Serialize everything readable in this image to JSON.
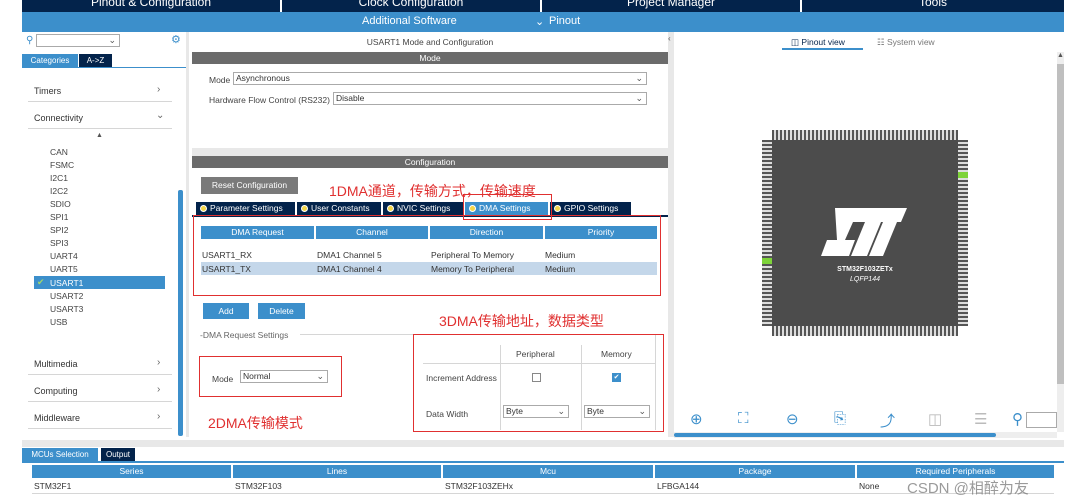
{
  "top_tabs": [
    "Pinout & Configuration",
    "Clock Configuration",
    "Project Manager",
    "Tools"
  ],
  "sub_menu": {
    "additional": "Additional Software",
    "pinout": "Pinout"
  },
  "left": {
    "cat_tab": "Categories",
    "az_tab": "A->Z",
    "categories": [
      "Timers",
      "Connectivity",
      "Multimedia",
      "Computing",
      "Middleware"
    ],
    "peripherals": [
      "CAN",
      "FSMC",
      "I2C1",
      "I2C2",
      "SDIO",
      "SPI1",
      "SPI2",
      "SPI3",
      "UART4",
      "UART5",
      "USART1",
      "USART2",
      "USART3",
      "USB"
    ],
    "selected": "USART1"
  },
  "mode_panel": {
    "title": "USART1 Mode and Configuration",
    "mode_header": "Mode",
    "mode_label": "Mode",
    "mode_value": "Asynchronous",
    "flow_label": "Hardware Flow Control (RS232)",
    "flow_value": "Disable"
  },
  "config": {
    "header": "Configuration",
    "reset": "Reset Configuration",
    "tabs": [
      "Parameter Settings",
      "User Constants",
      "NVIC Settings",
      "DMA Settings",
      "GPIO Settings"
    ],
    "dma_columns": [
      "DMA Request",
      "Channel",
      "Direction",
      "Priority"
    ],
    "dma_rows": [
      [
        "USART1_RX",
        "DMA1 Channel 5",
        "Peripheral To Memory",
        "Medium"
      ],
      [
        "USART1_TX",
        "DMA1 Channel 4",
        "Memory To Peripheral",
        "Medium"
      ]
    ],
    "add": "Add",
    "delete": "Delete",
    "request_settings": "DMA Request Settings",
    "mode_label": "Mode",
    "mode_value": "Normal",
    "peripheral_col": "Peripheral",
    "memory_col": "Memory",
    "increment_label": "Increment Address",
    "data_width_label": "Data Width",
    "periph_width": "Byte",
    "mem_width": "Byte"
  },
  "annotations": {
    "a1": "1DMA通道，传输方式，传输速度",
    "a2": "2DMA传输模式",
    "a3": "3DMA传输地址，数据类型"
  },
  "right": {
    "pinout_view": "Pinout view",
    "system_view": "System view",
    "chip_name": "STM32F103ZETx",
    "chip_pkg": "LQFP144"
  },
  "bottom": {
    "tab1": "MCUs Selection",
    "tab2": "Output",
    "columns": [
      "Series",
      "Lines",
      "Mcu",
      "Package",
      "Required Peripherals"
    ],
    "row": [
      "STM32F1",
      "STM32F103",
      "STM32F103ZEHx",
      "LFBGA144",
      "None"
    ]
  },
  "watermark": "CSDN @相醉为友",
  "colors": {
    "navy": "#03234b",
    "blue": "#3c8fcb",
    "annotation": "#e03030"
  }
}
